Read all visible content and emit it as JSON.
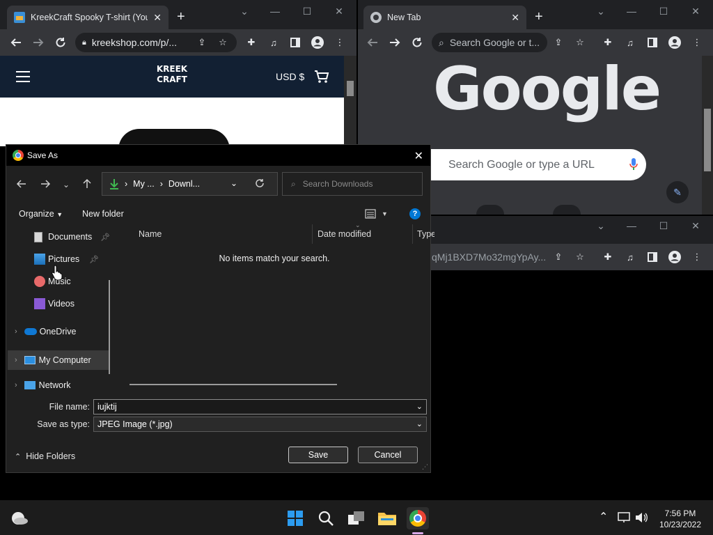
{
  "left_window": {
    "tab_title": "KreekCraft Spooky T-shirt (YouTube...",
    "url": "kreekshop.com/p/...",
    "logo_line1": "KREEK",
    "logo_line2": "CRAFT",
    "currency": "USD $"
  },
  "right_window": {
    "tab_title": "New Tab",
    "omnibox_placeholder": "Search Google or t...",
    "google_logo": "Google",
    "search_placeholder": "Search Google or type a URL"
  },
  "back_window": {
    "url": "qMj1BXD7Mo32mgYpAy..."
  },
  "dialog": {
    "title": "Save As",
    "breadcrumb": [
      "My ...",
      "Downl..."
    ],
    "search_placeholder": "Search Downloads",
    "organize_label": "Organize",
    "new_folder_label": "New folder",
    "nav_items": [
      {
        "label": "Documents",
        "pinned": true
      },
      {
        "label": "Pictures",
        "pinned": true
      },
      {
        "label": "Music",
        "pinned": false
      },
      {
        "label": "Videos",
        "pinned": false
      },
      {
        "label": "OneDrive",
        "pinned": false
      },
      {
        "label": "My Computer",
        "pinned": false
      },
      {
        "label": "Network",
        "pinned": false
      }
    ],
    "columns": [
      "Name",
      "Date modified",
      "Type"
    ],
    "empty_message": "No items match your search.",
    "file_name_label": "File name:",
    "file_name_value": "iujktij",
    "save_type_label": "Save as type:",
    "save_type_value": "JPEG Image (*.jpg)",
    "hide_folders_label": "Hide Folders",
    "save_label": "Save",
    "cancel_label": "Cancel"
  },
  "taskbar": {
    "time": "7:56 PM",
    "date": "10/23/2022"
  },
  "colors": {
    "chrome_frame": "#202124",
    "chrome_toolbar": "#35363a",
    "kreek_header": "#122033",
    "dialog_bg": "#202020",
    "accent_blue": "#0078d4"
  }
}
